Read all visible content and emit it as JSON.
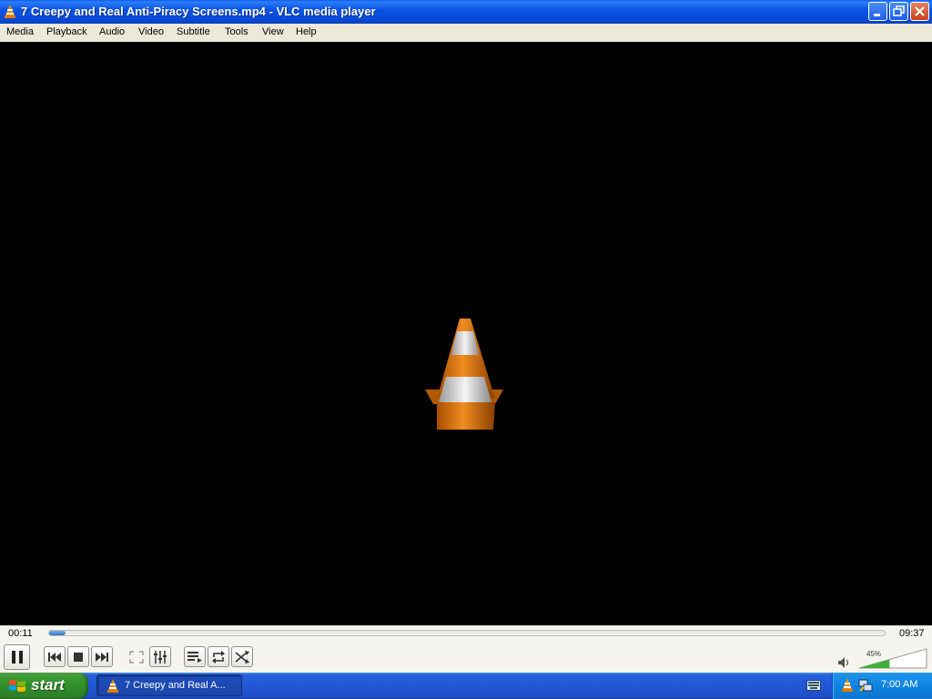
{
  "window": {
    "title": "7 Creepy and Real Anti-Piracy Screens.mp4 - VLC media player",
    "buttons": [
      "minimize-icon",
      "restore-icon",
      "close-icon"
    ]
  },
  "menu": {
    "items": [
      "Media",
      "Playback",
      "Audio",
      "Video",
      "Subtitle",
      "Tools",
      "View",
      "Help"
    ]
  },
  "playback": {
    "elapsed": "00:11",
    "total": "09:37",
    "progress_fraction": 0.019,
    "state": "playing"
  },
  "controls": {
    "buttons": [
      "pause-icon",
      "previous-icon",
      "stop-icon",
      "next-icon",
      "fullscreen-icon",
      "extended-settings-icon",
      "playlist-icon",
      "loop-icon",
      "shuffle-icon"
    ]
  },
  "volume": {
    "label": "45%",
    "level_fraction": 0.45
  },
  "taskbar": {
    "start_label": "start",
    "task_label": "7 Creepy and Real A...",
    "clock": "7:00 AM"
  },
  "colors": {
    "titlebar_blue": "#0b55e4",
    "vlc_orange": "#f08c00",
    "start_green": "#3c9b34",
    "tray_blue": "#0f83e0"
  }
}
